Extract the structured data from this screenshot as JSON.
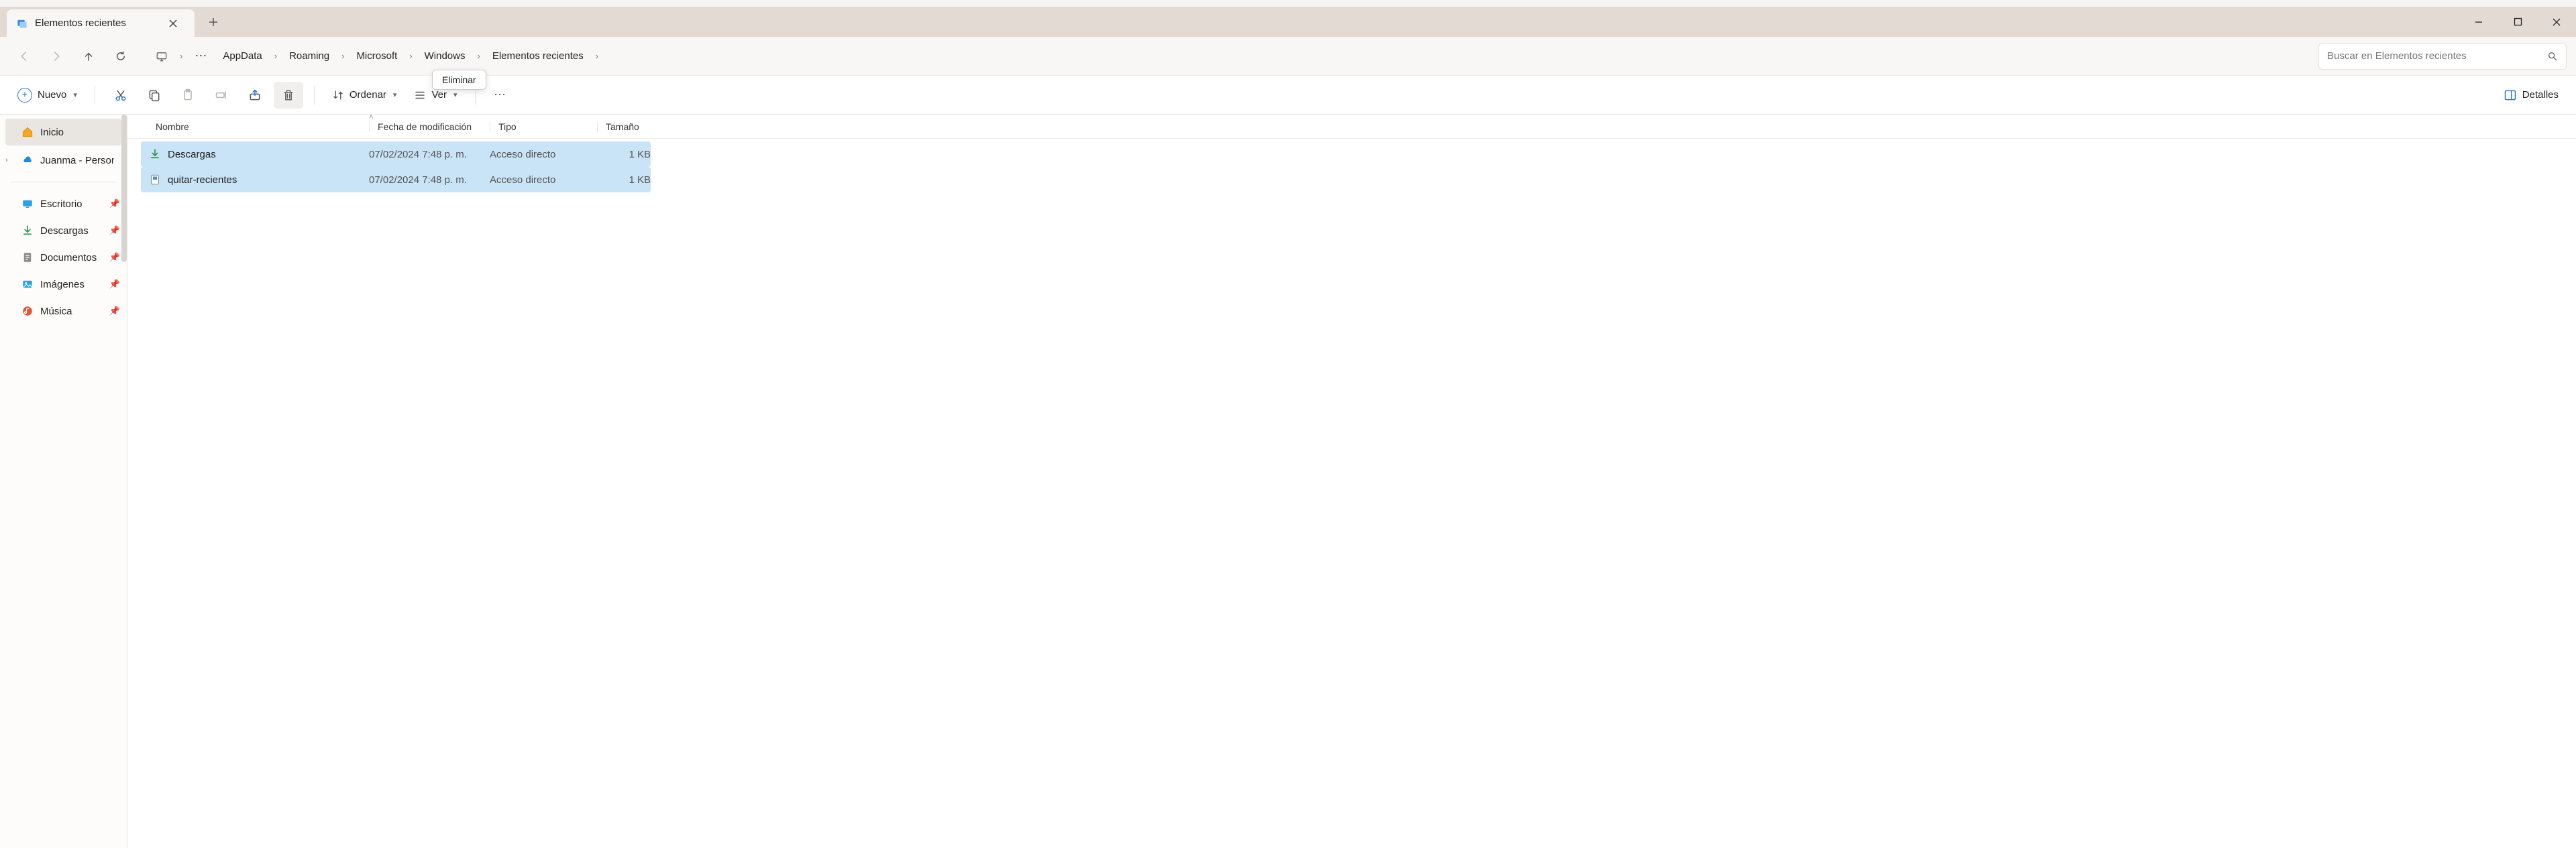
{
  "tab": {
    "title": "Elementos recientes"
  },
  "window_controls": {
    "minimize": "минимizar",
    "maximize": "maximizar",
    "close": "cerrar"
  },
  "breadcrumb": {
    "items": [
      "AppData",
      "Roaming",
      "Microsoft",
      "Windows",
      "Elementos recientes"
    ]
  },
  "tooltip": {
    "delete": "Eliminar"
  },
  "search": {
    "placeholder": "Buscar en Elementos recientes"
  },
  "toolbar": {
    "new_label": "Nuevo",
    "sort_label": "Ordenar",
    "view_label": "Ver",
    "details_label": "Detalles"
  },
  "sidebar": {
    "home": "Inicio",
    "personal": "Juanma - Personal",
    "quick": [
      {
        "label": "Escritorio",
        "icon": "desktop"
      },
      {
        "label": "Descargas",
        "icon": "download"
      },
      {
        "label": "Documentos",
        "icon": "document"
      },
      {
        "label": "Imágenes",
        "icon": "image"
      },
      {
        "label": "Música",
        "icon": "music"
      }
    ]
  },
  "columns": {
    "name": "Nombre",
    "date": "Fecha de modificación",
    "type": "Tipo",
    "size": "Tamaño"
  },
  "rows": [
    {
      "name": "Descargas",
      "date": "07/02/2024 7:48 p. m.",
      "type": "Acceso directo",
      "size": "1 KB",
      "icon": "download"
    },
    {
      "name": "quitar-recientes",
      "date": "07/02/2024 7:48 p. m.",
      "type": "Acceso directo",
      "size": "1 KB",
      "icon": "file"
    }
  ]
}
